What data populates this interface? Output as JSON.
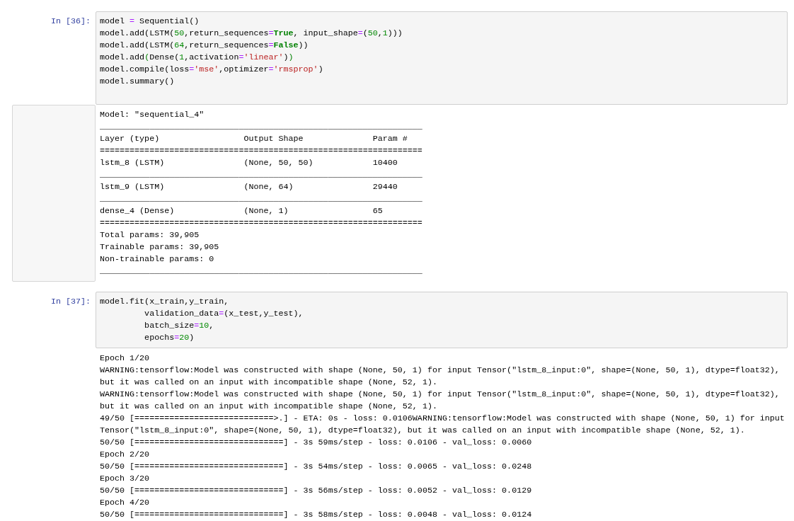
{
  "cells": [
    {
      "prompt": "In [36]:",
      "code": [
        [
          {
            "t": "model ",
            "kind": "plain"
          },
          {
            "t": "=",
            "kind": "operator"
          },
          {
            "t": " Sequential()",
            "kind": "plain"
          }
        ],
        [
          {
            "t": "model.add(LSTM(",
            "kind": "plain"
          },
          {
            "t": "50",
            "kind": "number"
          },
          {
            "t": ",return_sequences",
            "kind": "plain"
          },
          {
            "t": "=",
            "kind": "operator"
          },
          {
            "t": "True",
            "kind": "keyword"
          },
          {
            "t": ", input_shape",
            "kind": "plain"
          },
          {
            "t": "=",
            "kind": "operator"
          },
          {
            "t": "(",
            "kind": "plain"
          },
          {
            "t": "50",
            "kind": "number"
          },
          {
            "t": ",",
            "kind": "plain"
          },
          {
            "t": "1",
            "kind": "number"
          },
          {
            "t": ")))",
            "kind": "plain"
          }
        ],
        [
          {
            "t": "model.add(LSTM(",
            "kind": "plain"
          },
          {
            "t": "64",
            "kind": "number"
          },
          {
            "t": ",return_sequences",
            "kind": "plain"
          },
          {
            "t": "=",
            "kind": "operator"
          },
          {
            "t": "False",
            "kind": "keyword"
          },
          {
            "t": "))",
            "kind": "plain"
          }
        ],
        [
          {
            "t": "model.add",
            "kind": "plain"
          },
          {
            "t": "(",
            "kind": "bracket"
          },
          {
            "t": "Dense(",
            "kind": "plain"
          },
          {
            "t": "1",
            "kind": "number"
          },
          {
            "t": ",activation",
            "kind": "plain"
          },
          {
            "t": "=",
            "kind": "operator"
          },
          {
            "t": "'linear'",
            "kind": "string"
          },
          {
            "t": ")",
            "kind": "plain"
          },
          {
            "t": ")",
            "kind": "bracket"
          }
        ],
        [
          {
            "t": "model.compile(loss",
            "kind": "plain"
          },
          {
            "t": "=",
            "kind": "operator"
          },
          {
            "t": "'mse'",
            "kind": "string"
          },
          {
            "t": ",optimizer",
            "kind": "plain"
          },
          {
            "t": "=",
            "kind": "operator"
          },
          {
            "t": "'rmsprop'",
            "kind": "string"
          },
          {
            "t": ")",
            "kind": "plain"
          }
        ],
        [
          {
            "t": "model.summary()",
            "kind": "plain"
          }
        ]
      ],
      "output": {
        "scrolled": true,
        "lines": [
          "Model: \"sequential_4\"",
          "_________________________________________________________________",
          "Layer (type)                 Output Shape              Param #   ",
          "=================================================================",
          "lstm_8 (LSTM)                (None, 50, 50)            10400     ",
          "_________________________________________________________________",
          "lstm_9 (LSTM)                (None, 64)                29440     ",
          "_________________________________________________________________",
          "dense_4 (Dense)              (None, 1)                 65        ",
          "=================================================================",
          "Total params: 39,905",
          "Trainable params: 39,905",
          "Non-trainable params: 0",
          "_________________________________________________________________"
        ]
      }
    },
    {
      "prompt": "In [37]:",
      "code": [
        [
          {
            "t": "model.fit(x_train,y_train,",
            "kind": "plain"
          }
        ],
        [
          {
            "t": "         validation_data",
            "kind": "plain"
          },
          {
            "t": "=",
            "kind": "operator"
          },
          {
            "t": "(x_test,y_test),",
            "kind": "plain"
          }
        ],
        [
          {
            "t": "         batch_size",
            "kind": "plain"
          },
          {
            "t": "=",
            "kind": "operator"
          },
          {
            "t": "10",
            "kind": "number"
          },
          {
            "t": ",",
            "kind": "plain"
          }
        ],
        [
          {
            "t": "         epochs",
            "kind": "plain"
          },
          {
            "t": "=",
            "kind": "operator"
          },
          {
            "t": "20",
            "kind": "number"
          },
          {
            "t": ")",
            "kind": "plain"
          }
        ]
      ],
      "output": {
        "scrolled": false,
        "lines": [
          "Epoch 1/20",
          "WARNING:tensorflow:Model was constructed with shape (None, 50, 1) for input Tensor(\"lstm_8_input:0\", shape=(None, 50, 1), dtype=float32),",
          "but it was called on an input with incompatible shape (None, 52, 1).",
          "WARNING:tensorflow:Model was constructed with shape (None, 50, 1) for input Tensor(\"lstm_8_input:0\", shape=(None, 50, 1), dtype=float32),",
          "but it was called on an input with incompatible shape (None, 52, 1).",
          "49/50 [============================>.] - ETA: 0s - loss: 0.0106WARNING:tensorflow:Model was constructed with shape (None, 50, 1) for input",
          "Tensor(\"lstm_8_input:0\", shape=(None, 50, 1), dtype=float32), but it was called on an input with incompatible shape (None, 52, 1).",
          "50/50 [==============================] - 3s 59ms/step - loss: 0.0106 - val_loss: 0.0060",
          "Epoch 2/20",
          "50/50 [==============================] - 3s 54ms/step - loss: 0.0065 - val_loss: 0.0248",
          "Epoch 3/20",
          "50/50 [==============================] - 3s 56ms/step - loss: 0.0052 - val_loss: 0.0129",
          "Epoch 4/20",
          "50/50 [==============================] - 3s 58ms/step - loss: 0.0048 - val_loss: 0.0124"
        ]
      }
    }
  ]
}
